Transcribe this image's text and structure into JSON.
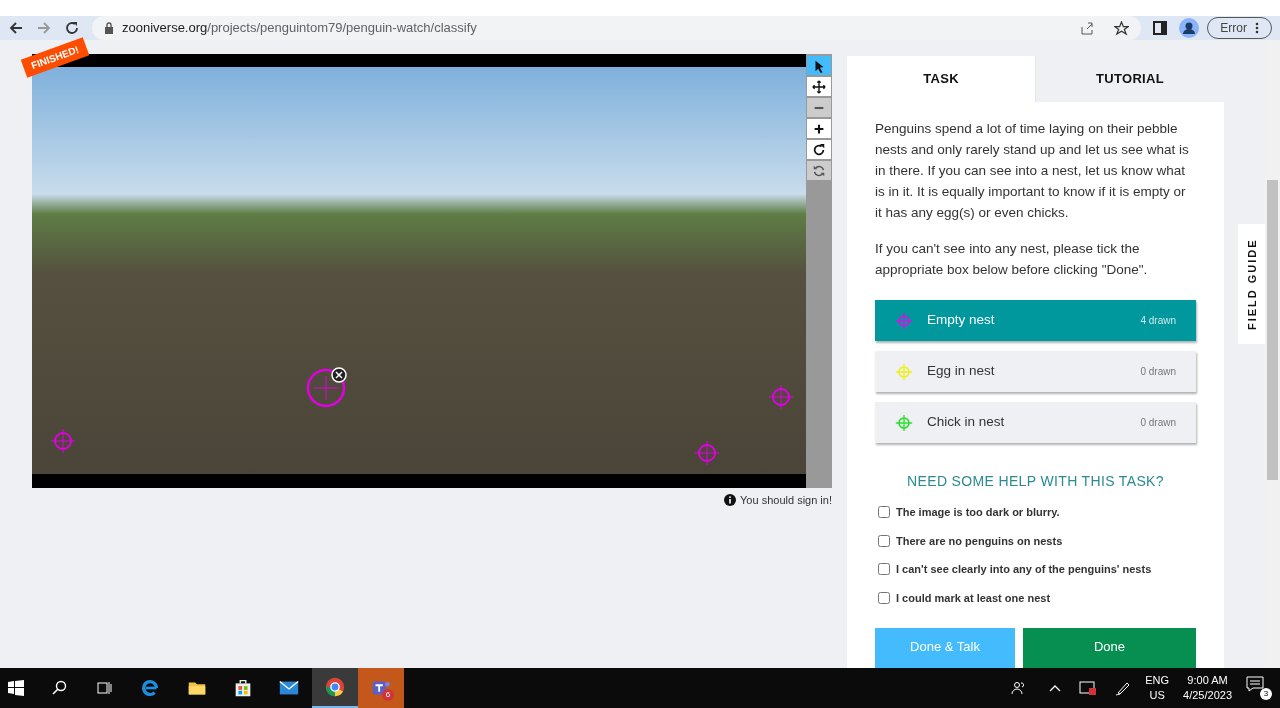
{
  "browser": {
    "url_host": "zooniverse.org",
    "url_path": "/projects/penguintom79/penguin-watch/classify",
    "profile_label": "Error"
  },
  "subject": {
    "badge": "FINISHED!",
    "tools": [
      {
        "kind": "pointer",
        "selected": true,
        "disabled": false
      },
      {
        "kind": "move",
        "selected": false,
        "disabled": false
      },
      {
        "kind": "zoom-out",
        "selected": false,
        "disabled": true
      },
      {
        "kind": "zoom-in",
        "selected": false,
        "disabled": false
      },
      {
        "kind": "rotate",
        "selected": false,
        "disabled": false
      },
      {
        "kind": "reset",
        "selected": false,
        "disabled": true
      }
    ],
    "notice": "You should sign in!"
  },
  "tabs": [
    {
      "label": "TASK",
      "selected": true
    },
    {
      "label": "TUTORIAL",
      "selected": false
    }
  ],
  "task": {
    "paragraphs": [
      "Penguins spend a lot of time laying on their pebble nests and only rarely stand up and let us see what is in there. If you can see into a nest, let us know what is in it. It is equally important to know if it is empty or it has any egg(s) or even chicks.",
      "If you can't see into any nest, please tick the appropriate box below before clicking \"Done\"."
    ],
    "tools": [
      {
        "label": "Empty nest",
        "count": "4 drawn",
        "color": "#c020e0",
        "selected": true
      },
      {
        "label": "Egg in nest",
        "count": "0 drawn",
        "color": "#f0f020",
        "selected": false
      },
      {
        "label": "Chick in nest",
        "count": "0 drawn",
        "color": "#30e030",
        "selected": false
      }
    ],
    "help_heading": "NEED SOME HELP WITH THIS TASK?",
    "options": [
      {
        "label": "The image is too dark or blurry.",
        "checked": false
      },
      {
        "label": "There are no penguins on nests",
        "checked": false
      },
      {
        "label": "I can't see clearly into any of the penguins' nests",
        "checked": false
      },
      {
        "label": "I could mark at least one nest",
        "checked": false
      }
    ],
    "buttons": [
      {
        "label": "Done & Talk",
        "kind": "talk"
      },
      {
        "label": "Done",
        "kind": "done"
      }
    ]
  },
  "field_guide": "FIELD GUIDE",
  "taskbar": {
    "apps": [
      {
        "kind": "edge",
        "selected": false
      },
      {
        "kind": "explorer",
        "selected": false
      },
      {
        "kind": "store",
        "selected": false
      },
      {
        "kind": "mail",
        "selected": false
      },
      {
        "kind": "chrome",
        "selected": true
      },
      {
        "kind": "teams",
        "selected": false,
        "badge": "6"
      }
    ],
    "language": "ENG",
    "region": "US",
    "time": "9:00 AM",
    "date": "4/25/2023",
    "notifications": "3"
  }
}
